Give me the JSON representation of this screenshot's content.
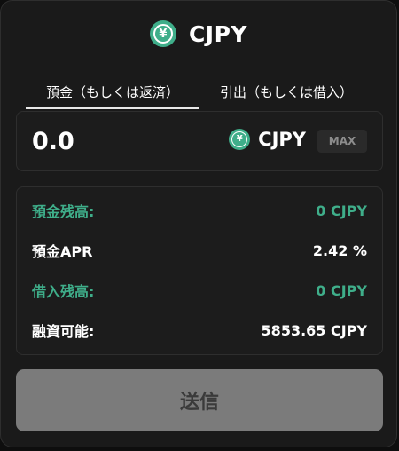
{
  "header": {
    "title": "CJPY",
    "icon": "yen-coin-icon"
  },
  "tabs": [
    {
      "label": "預金（もしくは返済）",
      "active": true
    },
    {
      "label": "引出（もしくは借入）",
      "active": false
    }
  ],
  "input": {
    "value": "0.0",
    "token": "CJPY",
    "max_label": "MAX"
  },
  "info": [
    {
      "label": "預金残高:",
      "value": "0 CJPY",
      "color": "#3fae8a"
    },
    {
      "label": "預金APR",
      "value": "2.42 %",
      "color": "#ffffff"
    },
    {
      "label": "借入残高:",
      "value": "0 CJPY",
      "color": "#3fae8a"
    },
    {
      "label": "融資可能:",
      "value": "5853.65 CJPY",
      "color": "#ffffff"
    }
  ],
  "submit": {
    "label": "送信"
  },
  "colors": {
    "accent": "#3fae8a",
    "button_disabled": "#7b7b7b"
  }
}
